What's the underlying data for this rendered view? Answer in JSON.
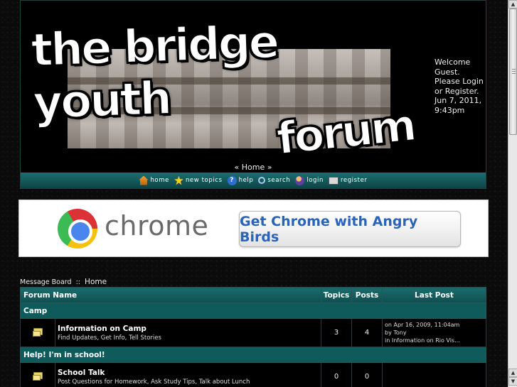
{
  "header": {
    "banner_line1": "the bridge youth",
    "banner_line2": "forum",
    "welcome": "Welcome Guest. Please Login or Register. Jun 7, 2011, 9:43pm",
    "home_crumb": "« Home »",
    "menu": [
      {
        "label": "home",
        "icon": "home-icon"
      },
      {
        "label": "new topics",
        "icon": "star-icon"
      },
      {
        "label": "help",
        "icon": "help-icon"
      },
      {
        "label": "search",
        "icon": "search-icon"
      },
      {
        "label": "login",
        "icon": "login-icon"
      },
      {
        "label": "register",
        "icon": "register-icon"
      }
    ]
  },
  "ad": {
    "brand": "chrome",
    "button_label": "Get Chrome with Angry Birds"
  },
  "breadcrumb": {
    "board": "Message Board",
    "sep": "::",
    "home": "Home"
  },
  "forum": {
    "headers": {
      "name": "Forum Name",
      "topics": "Topics",
      "posts": "Posts",
      "last": "Last Post"
    },
    "categories": [
      {
        "name": "Camp",
        "boards": [
          {
            "name": "Information on Camp",
            "desc": "Find Updates, Get Info, Tell Stories",
            "topics": "3",
            "posts": "4",
            "last_line1": "on Apr 16, 2009, 11:04am",
            "last_line2": "by Tony",
            "last_line3": "in Information on Rio Vis..."
          }
        ]
      },
      {
        "name": "Help! I'm in school!",
        "boards": [
          {
            "name": "School Talk",
            "desc": "Post Questions for Homework, Ask Study Tips, Talk about Lunch",
            "topics": "0",
            "posts": "0",
            "last_line1": "",
            "last_line2": "",
            "last_line3": ""
          }
        ]
      }
    ]
  },
  "colors": {
    "teal_bar": "#1b6c6d",
    "category_bg": "#0f5a5b",
    "ad_button_text": "#2a63b8"
  }
}
